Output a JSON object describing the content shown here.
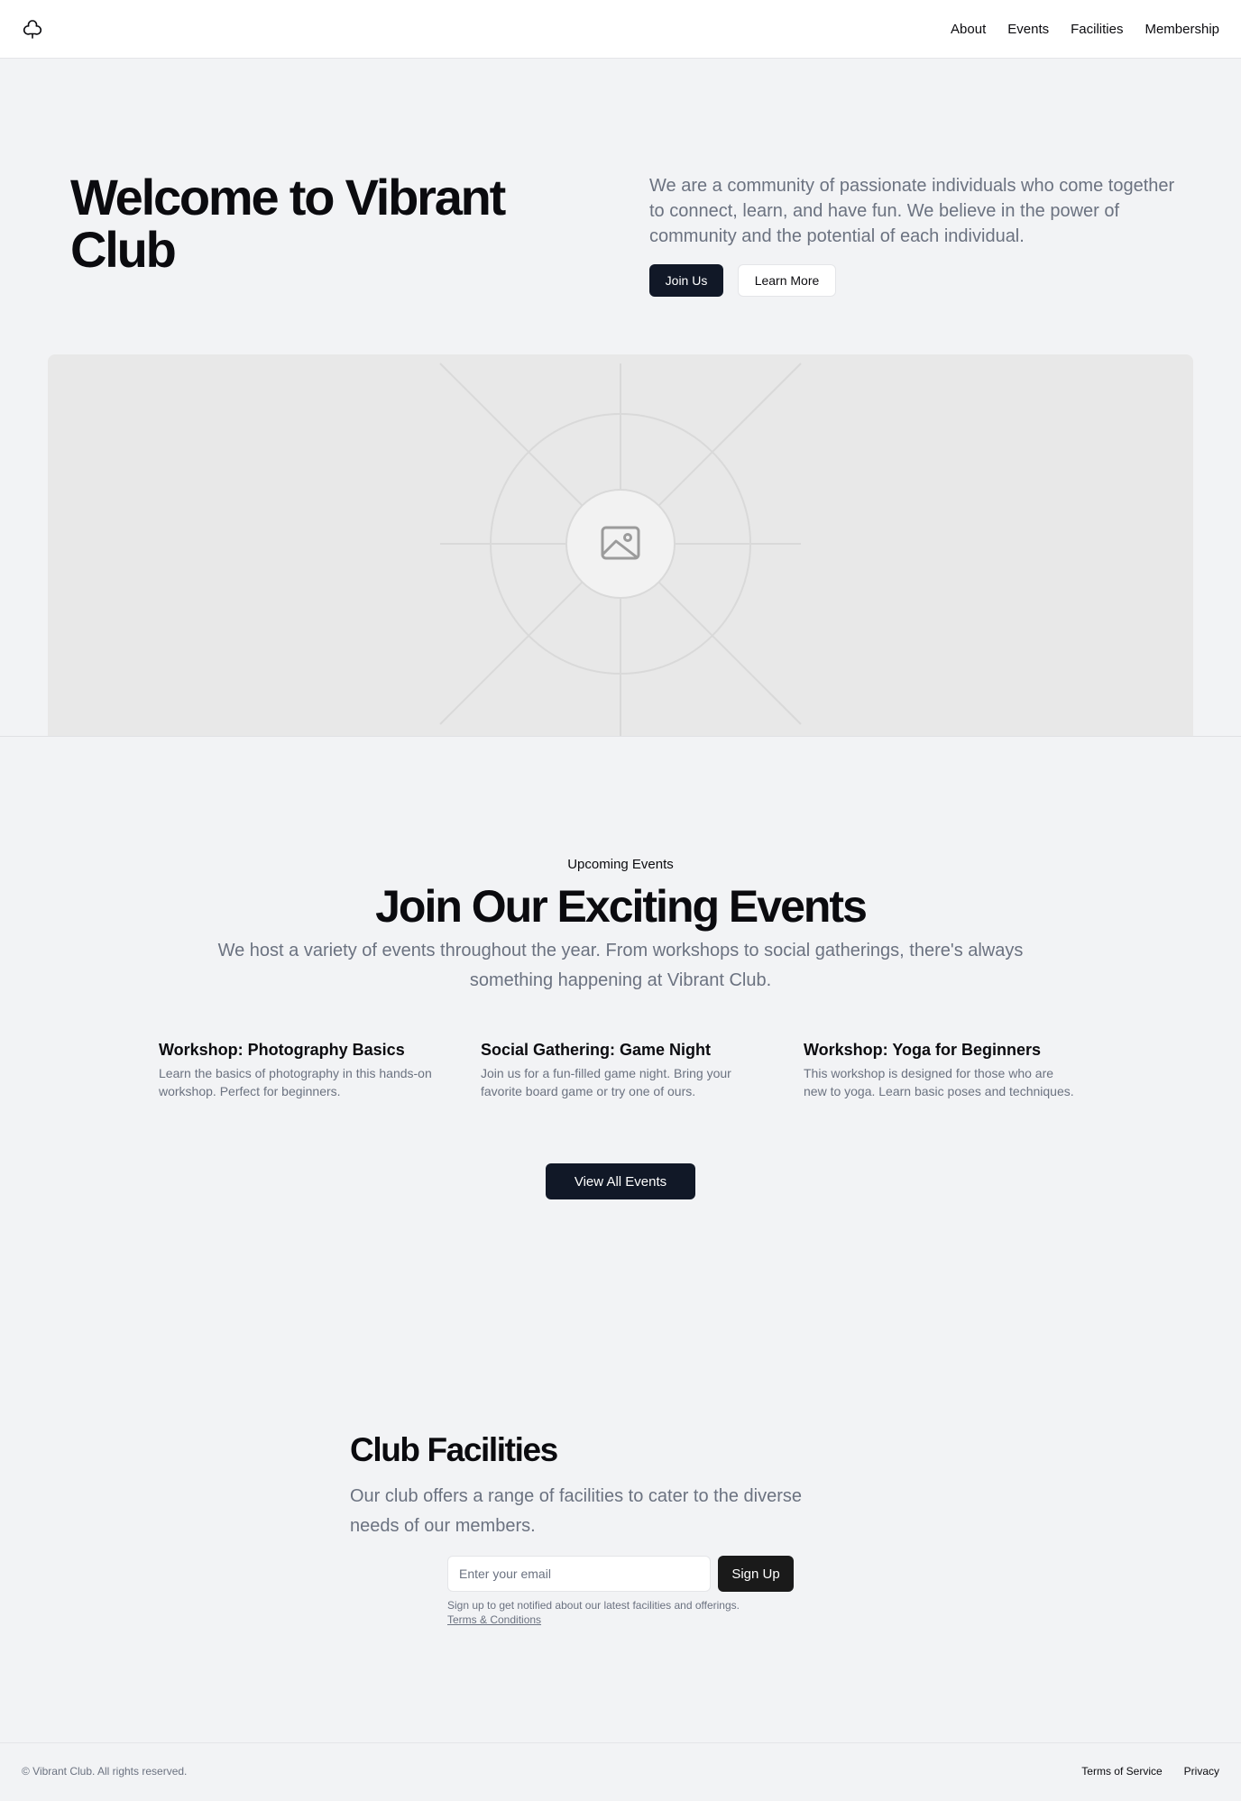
{
  "header": {
    "logo_icon": "club-icon",
    "nav": [
      {
        "label": "About"
      },
      {
        "label": "Events"
      },
      {
        "label": "Facilities"
      },
      {
        "label": "Membership"
      }
    ]
  },
  "hero": {
    "title": "Welcome to Vibrant Club",
    "description": "We are a community of passionate individuals who come together to connect, learn, and have fun. We believe in the power of community and the potential of each individual.",
    "join_label": "Join Us",
    "learn_label": "Learn More",
    "image_icon": "image-placeholder-icon"
  },
  "events": {
    "eyebrow": "Upcoming Events",
    "title": "Join Our Exciting Events",
    "description": "We host a variety of events throughout the year. From workshops to social gatherings, there's always something happening at Vibrant Club.",
    "items": [
      {
        "title": "Workshop: Photography Basics",
        "description": "Learn the basics of photography in this hands-on workshop. Perfect for beginners."
      },
      {
        "title": "Social Gathering: Game Night",
        "description": "Join us for a fun-filled game night. Bring your favorite board game or try one of ours."
      },
      {
        "title": "Workshop: Yoga for Beginners",
        "description": "This workshop is designed for those who are new to yoga. Learn basic poses and techniques."
      }
    ],
    "view_all_label": "View All Events"
  },
  "facilities": {
    "title": "Club Facilities",
    "description": "Our club offers a range of facilities to cater to the diverse needs of our members.",
    "email_placeholder": "Enter your email",
    "email_value": "",
    "signup_label": "Sign Up",
    "note": "Sign up to get notified about our latest facilities and offerings.",
    "terms_label": "Terms & Conditions"
  },
  "footer": {
    "copyright": "© Vibrant Club. All rights reserved.",
    "links": [
      {
        "label": "Terms of Service"
      },
      {
        "label": "Privacy"
      }
    ]
  },
  "colors": {
    "page_bg": "#f2f3f5",
    "primary_button": "#111827",
    "muted_text": "#6b7280"
  }
}
